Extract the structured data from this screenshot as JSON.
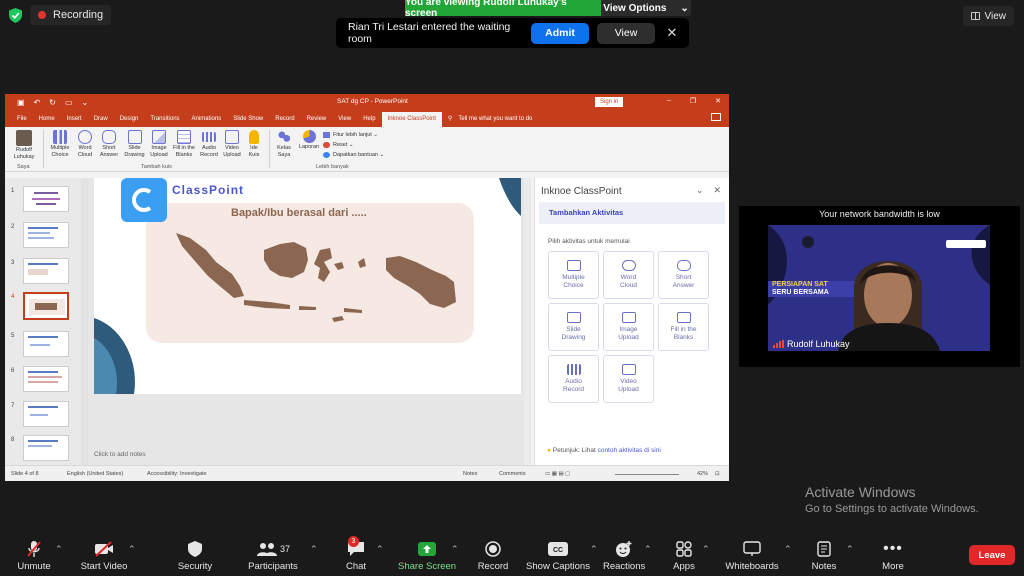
{
  "recording": {
    "label": "Recording"
  },
  "share_banner": {
    "viewing": "You are viewing Rudolf Luhukay's screen",
    "view_options": "View Options"
  },
  "top_view": {
    "label": "View"
  },
  "notification": {
    "message": "Rian Tri Lestari entered the waiting room",
    "admit": "Admit",
    "view": "View"
  },
  "ppt": {
    "title": "SAT dg CP  -  PowerPoint",
    "sign_in": "Sign in",
    "tabs": [
      "File",
      "Home",
      "Insert",
      "Draw",
      "Design",
      "Transitions",
      "Animations",
      "Slide Show",
      "Record",
      "Review",
      "View",
      "Help",
      "Inknoe ClassPoint"
    ],
    "tell_me": "Tell me what you want to do",
    "ribbon": {
      "user": [
        "Rudolf",
        "Luhukay"
      ],
      "user_group": "Saya",
      "buttons": [
        [
          "Multiple",
          "Choice"
        ],
        [
          "Word",
          "Cloud"
        ],
        [
          "Short",
          "Answer"
        ],
        [
          "Slide",
          "Drawing"
        ],
        [
          "Image",
          "Upload"
        ],
        [
          "Fill in the",
          "Blanks"
        ],
        [
          "Audio",
          "Record"
        ],
        [
          "Video",
          "Upload"
        ],
        [
          "Ide",
          "Kuis"
        ]
      ],
      "group_add": "Tambah kuis",
      "class_buttons": [
        [
          "Kelas",
          "Saya"
        ],
        [
          "Laporan",
          ""
        ]
      ],
      "list": [
        "Fitur lebih lanjut",
        "Reset",
        "Dapatkan bantuan"
      ],
      "group_more": "Lebih banyak"
    },
    "slide_numbers": [
      "1",
      "2",
      "3",
      "4",
      "5",
      "6",
      "7",
      "8"
    ],
    "slide": {
      "logo": "ClassPoint",
      "question": "Bapak/Ibu berasal dari ....."
    },
    "notes": "Click to add notes",
    "panel": {
      "title": "Inknoe ClassPoint",
      "subtitle": "Tambahkan Aktivitas",
      "hint": "Pilih aktivitas untuk memulai",
      "cards": [
        [
          "Multiple",
          "Choice"
        ],
        [
          "Word",
          "Cloud"
        ],
        [
          "Short",
          "Answer"
        ],
        [
          "Slide",
          "Drawing"
        ],
        [
          "Image",
          "Upload"
        ],
        [
          "Fill in the",
          "Blanks"
        ],
        [
          "Audio",
          "Record"
        ],
        [
          "Video",
          "Upload"
        ]
      ],
      "tip_prefix": "Petunjuk: Lihat",
      "tip_link": "contoh aktivitas di sini"
    },
    "status": {
      "slide": "Slide 4 of 8",
      "language": "English (United States)",
      "accessibility": "Accessibility: Investigate",
      "notes": "Notes",
      "comments": "Comments",
      "zoom": "42%"
    }
  },
  "video": {
    "bandwidth": "Your network bandwidth is low",
    "name": "Rudolf Luhukay",
    "background_text": [
      "PERSIAPAN SAT",
      "SERU BERSAMA"
    ]
  },
  "watermark": {
    "line1": "Activate Windows",
    "line2": "Go to Settings to activate Windows."
  },
  "toolbar": {
    "items": [
      "Unmute",
      "Start Video",
      "Security",
      "Participants",
      "Chat",
      "Share Screen",
      "Record",
      "Show Captions",
      "Reactions",
      "Apps",
      "Whiteboards",
      "Notes",
      "More"
    ],
    "participants_count": "37",
    "chat_badge": "3",
    "leave": "Leave"
  },
  "colors": {
    "ppt_accent": "#c43e1c",
    "share_green": "#23a638",
    "admit_blue": "#0e72ed",
    "leave_red": "#e02828",
    "map_brown": "#8b6650",
    "slide_bg": "#f6e9e4"
  }
}
